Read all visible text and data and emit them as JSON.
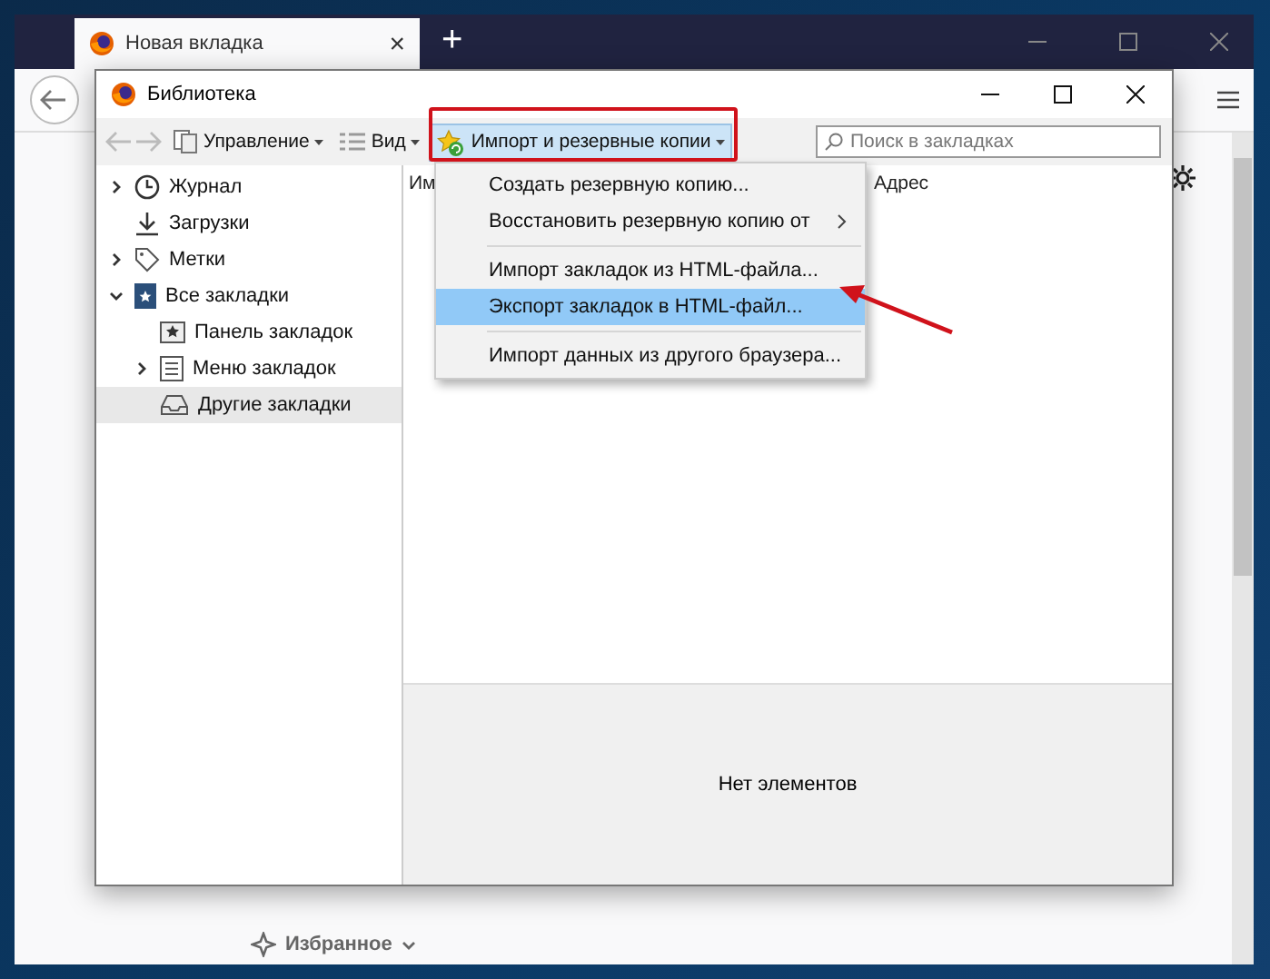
{
  "browser": {
    "tab": {
      "title": "Новая вкладка",
      "close": "×"
    },
    "new_tab": "+",
    "bookmarks_item": "Избранное"
  },
  "library": {
    "title": "Библиотека",
    "toolbar": [
      {
        "label": "Управление",
        "selected": false
      },
      {
        "label": "Вид",
        "selected": false
      },
      {
        "label": "Импорт и резервные копии",
        "selected": true
      }
    ],
    "search": {
      "placeholder": "Поиск в закладках"
    },
    "tree": [
      {
        "label": "Журнал",
        "expanded": false,
        "selected": false
      },
      {
        "label": "Загрузки",
        "selected": false
      },
      {
        "label": "Метки",
        "expanded": false,
        "selected": false
      },
      {
        "label": "Все закладки",
        "expanded": true,
        "selected": false,
        "children": [
          {
            "label": "Панель закладок",
            "selected": false
          },
          {
            "label": "Меню закладок",
            "expanded": false,
            "selected": false
          },
          {
            "label": "Другие закладки",
            "selected": true
          }
        ]
      }
    ],
    "columns": [
      "Им",
      "Адрес"
    ],
    "empty_text": "Нет элементов",
    "menu": [
      {
        "kind": "item",
        "label": "Создать резервную копию...",
        "selected": false,
        "submenu": false
      },
      {
        "kind": "item",
        "label": "Восстановить резервную копию от",
        "selected": false,
        "submenu": true
      },
      {
        "kind": "separator"
      },
      {
        "kind": "item",
        "label": "Импорт закладок из HTML-файла...",
        "selected": false,
        "submenu": false
      },
      {
        "kind": "item",
        "label": "Экспорт закладок в HTML-файл...",
        "selected": true,
        "submenu": false
      },
      {
        "kind": "separator"
      },
      {
        "kind": "item",
        "label": "Импорт данных из другого браузера...",
        "selected": false,
        "submenu": false
      }
    ]
  }
}
